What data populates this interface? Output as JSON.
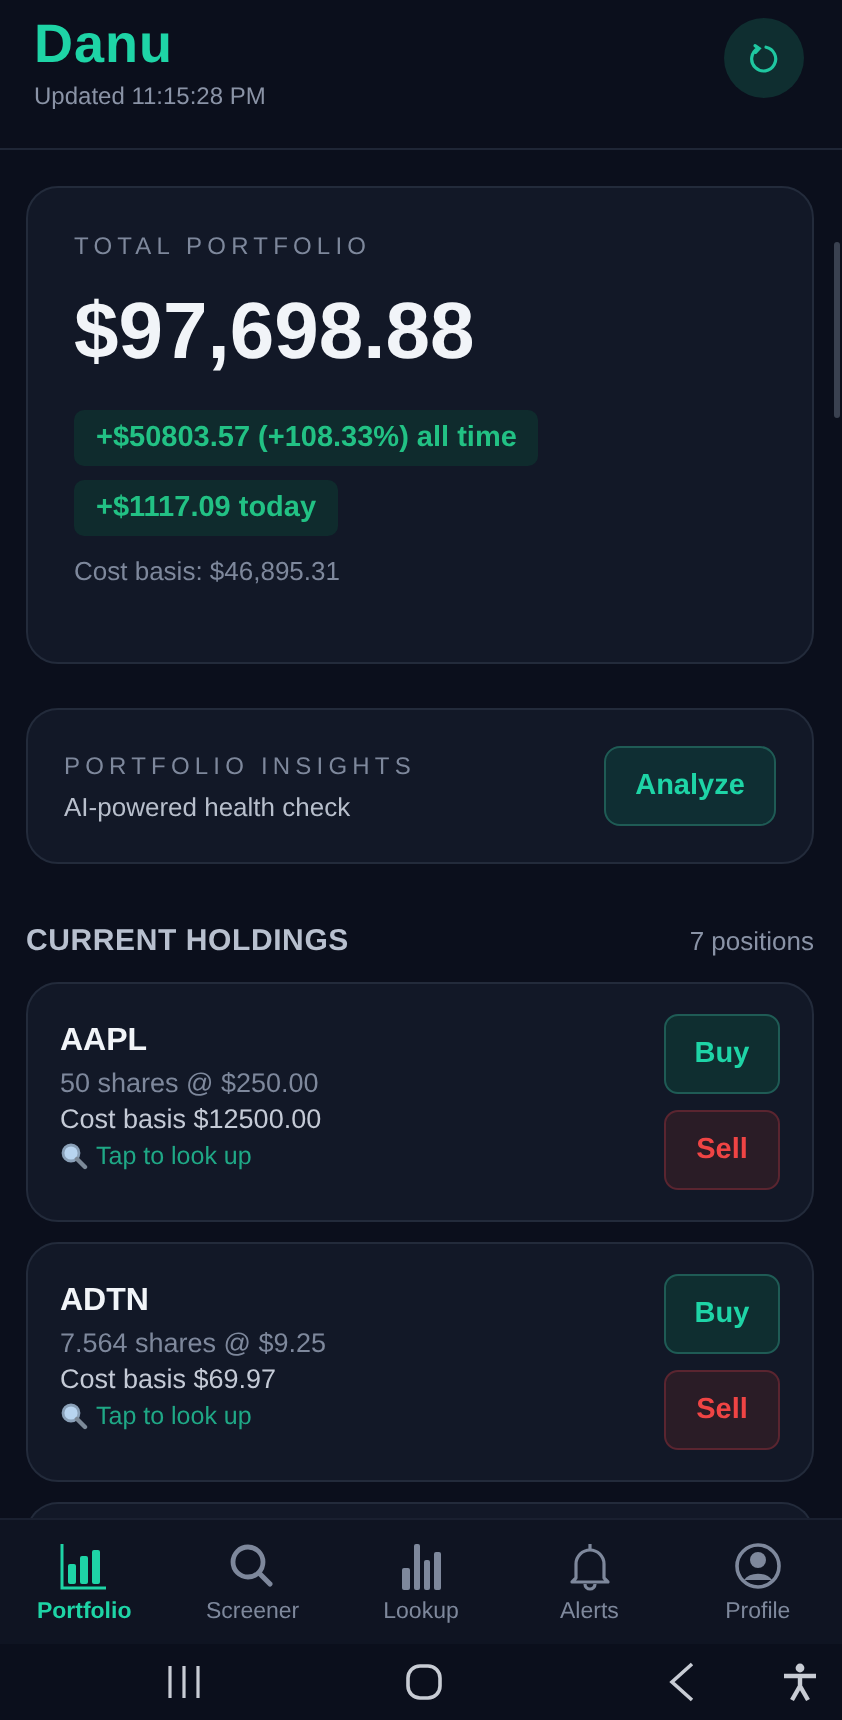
{
  "header": {
    "title": "Danu",
    "updated": "Updated 11:15:28 PM"
  },
  "portfolio": {
    "label": "TOTAL PORTFOLIO",
    "value": "$97,698.88",
    "changes": [
      "+$50803.57 (+108.33%) all time",
      "+$1117.09 today"
    ],
    "cost_basis": "Cost basis: $46,895.31"
  },
  "insights": {
    "label": "PORTFOLIO INSIGHTS",
    "subtitle": "AI-powered health check",
    "button": "Analyze"
  },
  "holdings": {
    "title": "CURRENT HOLDINGS",
    "count": "7 positions",
    "items": [
      {
        "symbol": "AAPL",
        "shares": "50 shares @ $250.00",
        "cost_basis": "Cost basis $12500.00",
        "lookup": "Tap to look up",
        "buy": "Buy",
        "sell": "Sell"
      },
      {
        "symbol": "ADTN",
        "shares": "7.564 shares @ $9.25",
        "cost_basis": "Cost basis $69.97",
        "lookup": "Tap to look up",
        "buy": "Buy",
        "sell": "Sell"
      }
    ]
  },
  "nav": [
    {
      "kind": "portfolio",
      "label": "Portfolio",
      "selected": true
    },
    {
      "kind": "screener",
      "label": "Screener",
      "selected": false
    },
    {
      "kind": "lookup",
      "label": "Lookup",
      "selected": false
    },
    {
      "kind": "alerts",
      "label": "Alerts",
      "selected": false
    },
    {
      "kind": "profile",
      "label": "Profile",
      "selected": false
    }
  ]
}
